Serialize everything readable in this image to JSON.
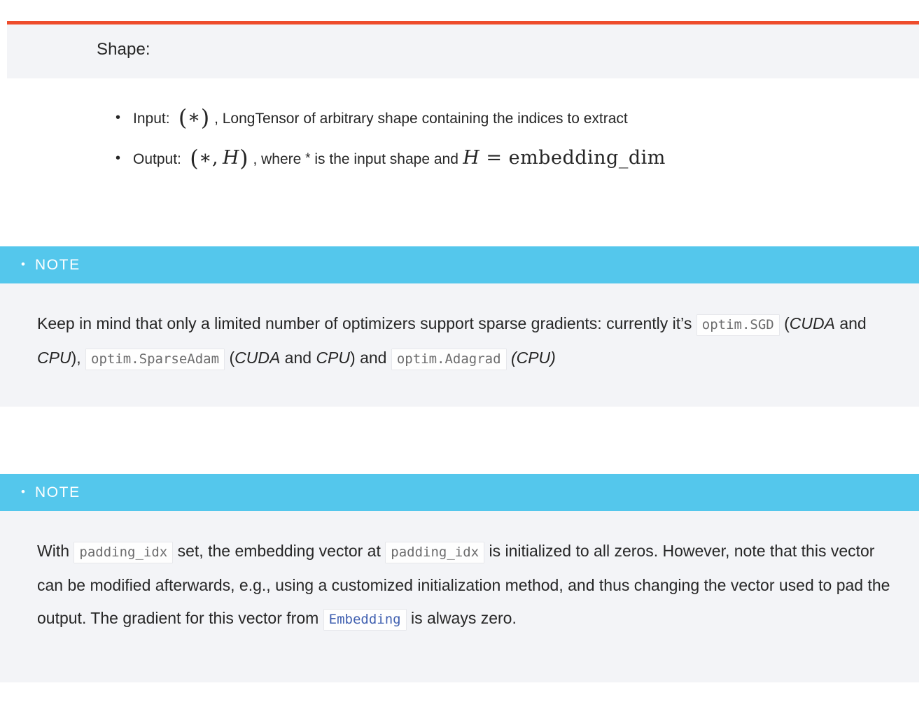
{
  "shape_section": {
    "title": "Shape:",
    "bullet_glyph": "•",
    "items": [
      {
        "label": "Input:",
        "math": "(∗)",
        "text": ", LongTensor of arbitrary shape containing the indices to extract"
      },
      {
        "label": "Output:",
        "math": "(∗,H)",
        "text_before": ", where * is the input shape and ",
        "math_after": "H = embedding_dim"
      }
    ]
  },
  "notes": [
    {
      "header": "NOTE",
      "header_bullet": "•",
      "text_parts": [
        "Keep in mind that only a limited number of optimizers support sparse gradients: currently it’s ",
        "optim.SGD",
        " (",
        "CUDA",
        " and ",
        "CPU",
        "), ",
        "optim.SparseAdam",
        " (",
        "CUDA",
        " and ",
        "CPU",
        ") and ",
        "optim.Adagrad",
        " (",
        "CPU",
        ")"
      ],
      "code_spans": [
        "optim.SGD",
        "optim.SparseAdam",
        "optim.Adagrad"
      ],
      "italic_spans": [
        "CUDA",
        "CPU"
      ]
    },
    {
      "header": "NOTE",
      "header_bullet": "•",
      "text_parts": [
        "With ",
        "padding_idx",
        " set, the embedding vector at ",
        "padding_idx",
        " is initialized to all zeros. However, note that this vector can be modified afterwards, e.g., using a customized initialization method, and thus changing the vector used to pad the output. The gradient for this vector from ",
        "Embedding",
        " is always zero."
      ],
      "code_spans": [
        "padding_idx",
        "padding_idx",
        "Embedding"
      ]
    }
  ],
  "note1_text": {
    "s1": "Keep in mind that only a limited number of optimizers support sparse gradients: currently it’s",
    "c1": "optim.SGD",
    "p_open": "(",
    "i_cuda": "CUDA",
    "s_and": "and",
    "i_cpu": "CPU",
    "p_close_comma": "),",
    "c2": "optim.SparseAdam",
    "p_close": ")",
    "s_and2": "and",
    "c3": "optim.Adagrad",
    "cpu_paren": "(CPU)"
  },
  "note2_text": {
    "s1": "With",
    "c1": "padding_idx",
    "s2": "set, the embedding vector at",
    "c2": "padding_idx",
    "s3": "is initialized to all zeros. However, note that this vector can be modified afterwards, e.g., using a customized initialization method, and thus changing the vector used to pad the output. The gradient for this vector from",
    "c3": "Embedding",
    "s4": "is always zero."
  },
  "colors": {
    "accent_orange": "#ee4c2c",
    "note_cyan": "#54c7ec",
    "panel_gray": "#f3f4f7",
    "text": "#262626",
    "code_text": "#6c6c6d",
    "code_link": "#4060b0"
  }
}
